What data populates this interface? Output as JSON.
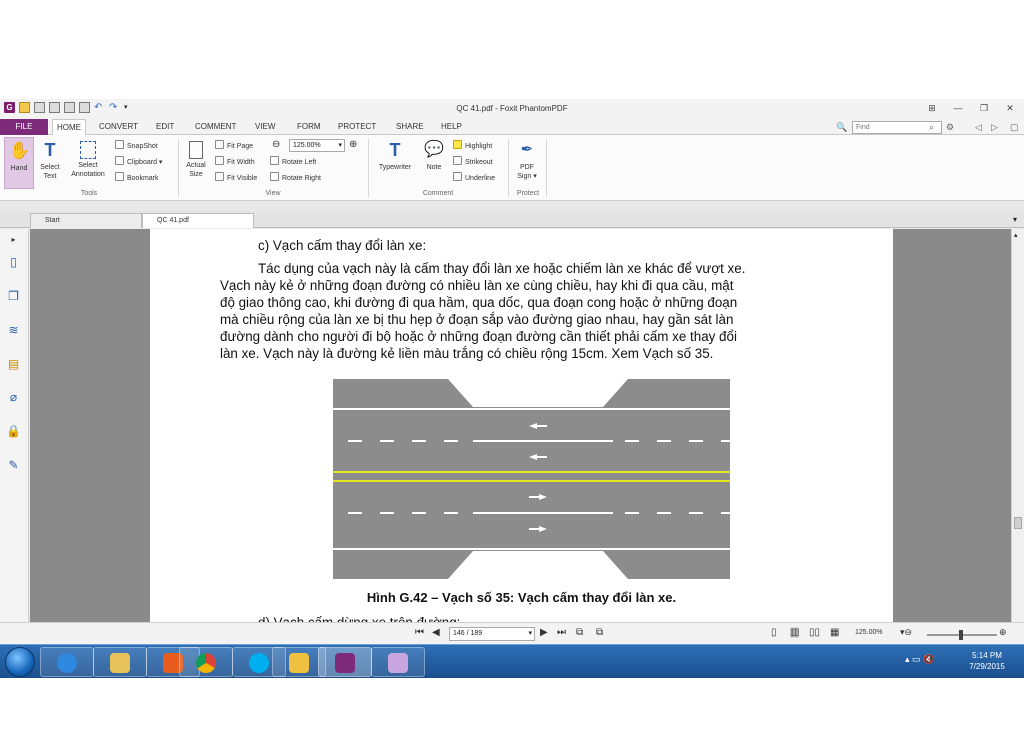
{
  "window": {
    "title": "QC 41.pdf - Foxit PhantomPDF",
    "controls": [
      "⊞",
      "—",
      "❐",
      "✕"
    ]
  },
  "ribbon_tabs": {
    "file": "FILE",
    "tabs": [
      "HOME",
      "CONVERT",
      "EDIT",
      "COMMENT",
      "VIEW",
      "FORM",
      "PROTECT",
      "SHARE",
      "HELP"
    ],
    "find_placeholder": "Find"
  },
  "ribbon": {
    "hand": "Hand",
    "select_text": [
      "Select",
      "Text"
    ],
    "select_annotation": [
      "Select",
      "Annotation"
    ],
    "snapshot": "SnapShot",
    "clipboard": "Clipboard",
    "bookmark": "Bookmark",
    "tools_label": "Tools",
    "actual_size": [
      "Actual",
      "Size"
    ],
    "fit_page": "Fit Page",
    "fit_width": "Fit Width",
    "fit_visible": "Fit Visible",
    "zoom_value": "125.00%",
    "rotate_left": "Rotate Left",
    "rotate_right": "Rotate Right",
    "view_label": "View",
    "typewriter": "Typewriter",
    "note": "Note",
    "highlight": "Highlight",
    "strikeout": "Strikeout",
    "underline": "Underline",
    "comment_label": "Comment",
    "pdf_sign": [
      "PDF",
      "Sign"
    ],
    "protect_label": "Protect"
  },
  "doc_tabs": [
    "Start",
    "QC 41.pdf"
  ],
  "document": {
    "heading": "c) Vạch cấm thay đổi làn xe:",
    "paragraph_lines": [
      "Tác dụng của vạch này là cấm thay đổi làn xe hoặc chiếm làn xe khác để vượt xe.",
      "Vạch này kẻ ở những đoạn đường có nhiều làn xe cùng chiều, hay khi đi qua cầu, mật",
      "độ giao thông cao, khi đường đi qua hầm, qua dốc, qua đoạn cong hoặc ở những đoạn",
      "mà chiều rộng của làn xe bị thu hẹp ở đoạn sắp vào đường giao nhau, hay gần sát làn",
      "đường dành cho người đi bộ hoặc ở những đoạn đường cần thiết phải cấm xe thay đổi",
      "làn xe. Vạch này là đường kẻ liền màu trắng có chiều rộng 15cm. Xem Vạch số 35."
    ],
    "caption": "Hình G.42 – Vạch số 35: Vạch cấm thay đổi làn xe.",
    "next_line": "d) Vạch cấm dừng xe trên đường:"
  },
  "statusbar": {
    "page_value": "146 / 189",
    "zoom": "125.00%"
  },
  "taskbar": {
    "time": "5:14 PM",
    "date": "7/29/2015"
  },
  "colors": {
    "file_tab": "#7d2a7a",
    "road": "#8c8c8c",
    "center_line": "#e6e61e",
    "taskbar": "#1b4f8e"
  }
}
